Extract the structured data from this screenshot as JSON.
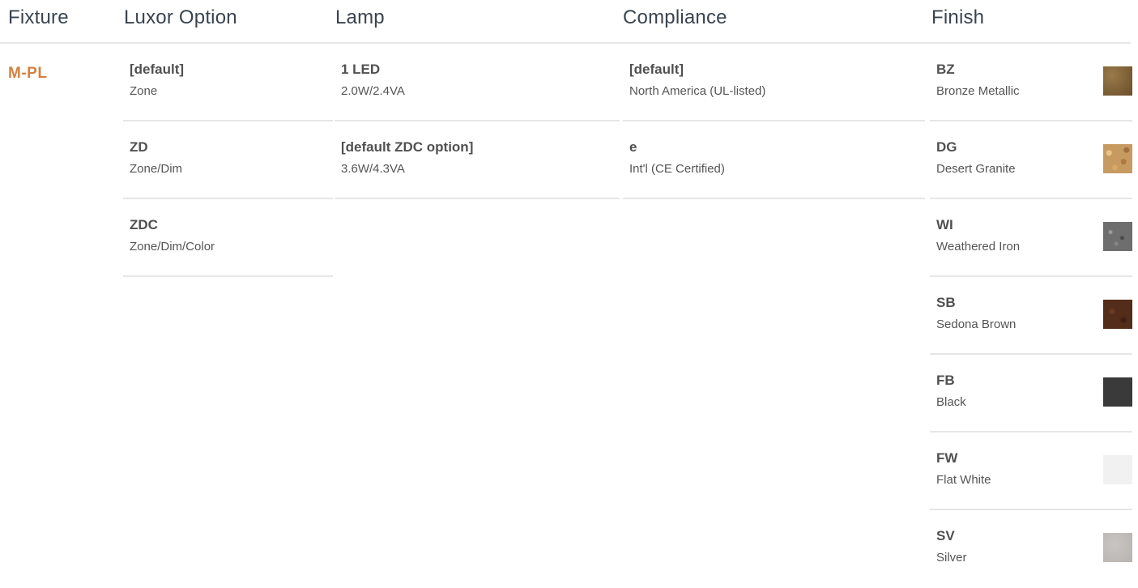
{
  "headers": {
    "fixture": "Fixture",
    "luxor_option": "Luxor Option",
    "lamp": "Lamp",
    "compliance": "Compliance",
    "finish": "Finish"
  },
  "fixture": {
    "code": "M-PL"
  },
  "luxor_options": [
    {
      "code": "[default]",
      "desc": "Zone"
    },
    {
      "code": "ZD",
      "desc": "Zone/Dim"
    },
    {
      "code": "ZDC",
      "desc": "Zone/Dim/Color"
    }
  ],
  "lamps": [
    {
      "code": "1 LED",
      "desc": "2.0W/2.4VA"
    },
    {
      "code": "[default ZDC option]",
      "desc": "3.6W/4.3VA"
    }
  ],
  "compliance": [
    {
      "code": "[default]",
      "desc": "North America (UL-listed)"
    },
    {
      "code": "e",
      "desc": "Int'l (CE Certified)"
    }
  ],
  "finishes": [
    {
      "code": "BZ",
      "desc": "Bronze Metallic",
      "swatch": "#7d5f36"
    },
    {
      "code": "DG",
      "desc": "Desert Granite",
      "swatch": "#c79a62"
    },
    {
      "code": "WI",
      "desc": "Weathered Iron",
      "swatch": "#6e6e6e"
    },
    {
      "code": "SB",
      "desc": "Sedona Brown",
      "swatch": "#542c1a"
    },
    {
      "code": "FB",
      "desc": "Black",
      "swatch": "#3a3a3a"
    },
    {
      "code": "FW",
      "desc": "Flat White",
      "swatch": "#f1f1f1"
    },
    {
      "code": "SV",
      "desc": "Silver",
      "swatch": "#bdb9b6"
    }
  ],
  "colors": {
    "accent": "#d5803f",
    "header_text": "#3a4450",
    "divider": "#e6e6e6"
  }
}
